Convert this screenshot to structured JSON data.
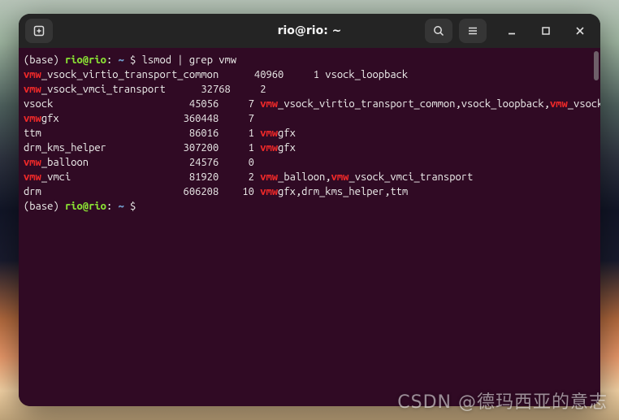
{
  "titlebar": {
    "title": "rio@rio: ~"
  },
  "prompt": {
    "env": "(base) ",
    "userhost": "rio@rio",
    "sep": ": ",
    "path": "~",
    "suffix": " $ "
  },
  "command": "lsmod | grep vmw",
  "highlight": "vmw",
  "rows": [
    {
      "module": "vmw_vsock_virtio_transport_common",
      "size": "40960",
      "used": "1",
      "by": "vsock_loopback"
    },
    {
      "module": "vmw_vsock_vmci_transport",
      "size": "32768",
      "used": "2",
      "by": ""
    },
    {
      "module": "vsock",
      "size": "45056",
      "used": "7",
      "by": "vmw_vsock_virtio_transport_common,vsock_loopback,vmw_vsock_vmci_transport"
    },
    {
      "module": "vmwgfx",
      "size": "360448",
      "used": "7",
      "by": ""
    },
    {
      "module": "ttm",
      "size": "86016",
      "used": "1",
      "by": "vmwgfx"
    },
    {
      "module": "drm_kms_helper",
      "size": "307200",
      "used": "1",
      "by": "vmwgfx"
    },
    {
      "module": "vmw_balloon",
      "size": "24576",
      "used": "0",
      "by": ""
    },
    {
      "module": "vmw_vmci",
      "size": "81920",
      "used": "2",
      "by": "vmw_balloon,vmw_vsock_vmci_transport"
    },
    {
      "module": "drm",
      "size": "606208",
      "used": "10",
      "by": "vmwgfx,drm_kms_helper,ttm"
    }
  ],
  "columns": {
    "module_w": 22,
    "size_w": 11,
    "used_w": 4
  },
  "watermark": "CSDN @德玛西亚的意志"
}
